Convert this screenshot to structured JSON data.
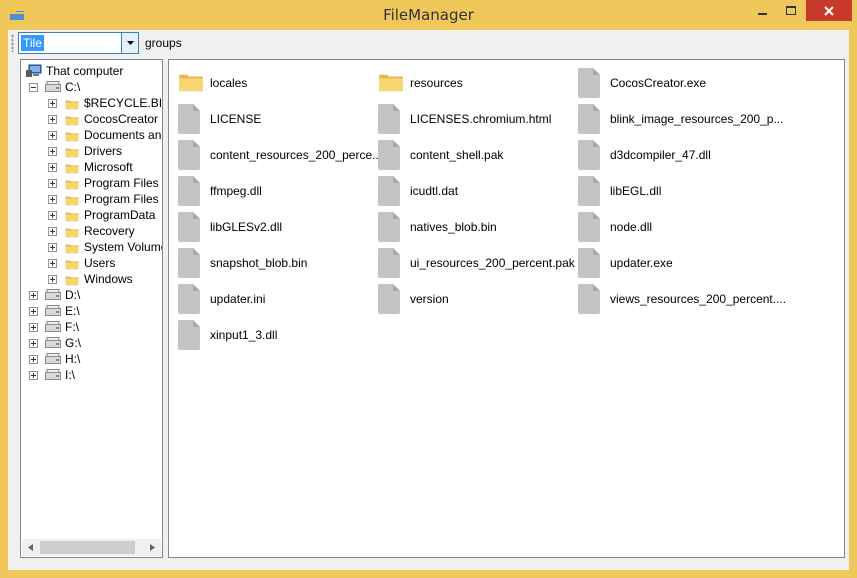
{
  "window": {
    "title": "FileManager",
    "accent": "#f0c75b",
    "close_color": "#c7392b"
  },
  "toolbar": {
    "view_mode": "Tile",
    "groups_label": "groups"
  },
  "tree": {
    "root_label": "That computer",
    "drives": [
      {
        "label": "C:\\",
        "expanded": true,
        "children": [
          "$RECYCLE.BIN",
          "CocosCreator",
          "Documents and",
          "Drivers",
          "Microsoft",
          "Program Files",
          "Program Files (xl",
          "ProgramData",
          "Recovery",
          "System Volume I",
          "Users",
          "Windows"
        ]
      },
      {
        "label": "D:\\",
        "expanded": false
      },
      {
        "label": "E:\\",
        "expanded": false
      },
      {
        "label": "F:\\",
        "expanded": false
      },
      {
        "label": "G:\\",
        "expanded": false
      },
      {
        "label": "H:\\",
        "expanded": false
      },
      {
        "label": "I:\\",
        "expanded": false
      }
    ]
  },
  "files": [
    {
      "name": "locales",
      "type": "folder"
    },
    {
      "name": "resources",
      "type": "folder"
    },
    {
      "name": "CocosCreator.exe",
      "type": "file"
    },
    {
      "name": "LICENSE",
      "type": "file"
    },
    {
      "name": "LICENSES.chromium.html",
      "type": "file"
    },
    {
      "name": "blink_image_resources_200_p...",
      "type": "file"
    },
    {
      "name": "content_resources_200_perce...",
      "type": "file"
    },
    {
      "name": "content_shell.pak",
      "type": "file"
    },
    {
      "name": "d3dcompiler_47.dll",
      "type": "file"
    },
    {
      "name": "ffmpeg.dll",
      "type": "file"
    },
    {
      "name": "icudtl.dat",
      "type": "file"
    },
    {
      "name": "libEGL.dll",
      "type": "file"
    },
    {
      "name": "libGLESv2.dll",
      "type": "file"
    },
    {
      "name": "natives_blob.bin",
      "type": "file"
    },
    {
      "name": "node.dll",
      "type": "file"
    },
    {
      "name": "snapshot_blob.bin",
      "type": "file"
    },
    {
      "name": "ui_resources_200_percent.pak",
      "type": "file"
    },
    {
      "name": "updater.exe",
      "type": "file"
    },
    {
      "name": "updater.ini",
      "type": "file"
    },
    {
      "name": "version",
      "type": "file"
    },
    {
      "name": "views_resources_200_percent....",
      "type": "file"
    },
    {
      "name": "xinput1_3.dll",
      "type": "file"
    }
  ],
  "icons": {
    "folder": "folder-icon",
    "file": "file-icon",
    "drive": "drive-icon",
    "computer": "computer-icon"
  }
}
